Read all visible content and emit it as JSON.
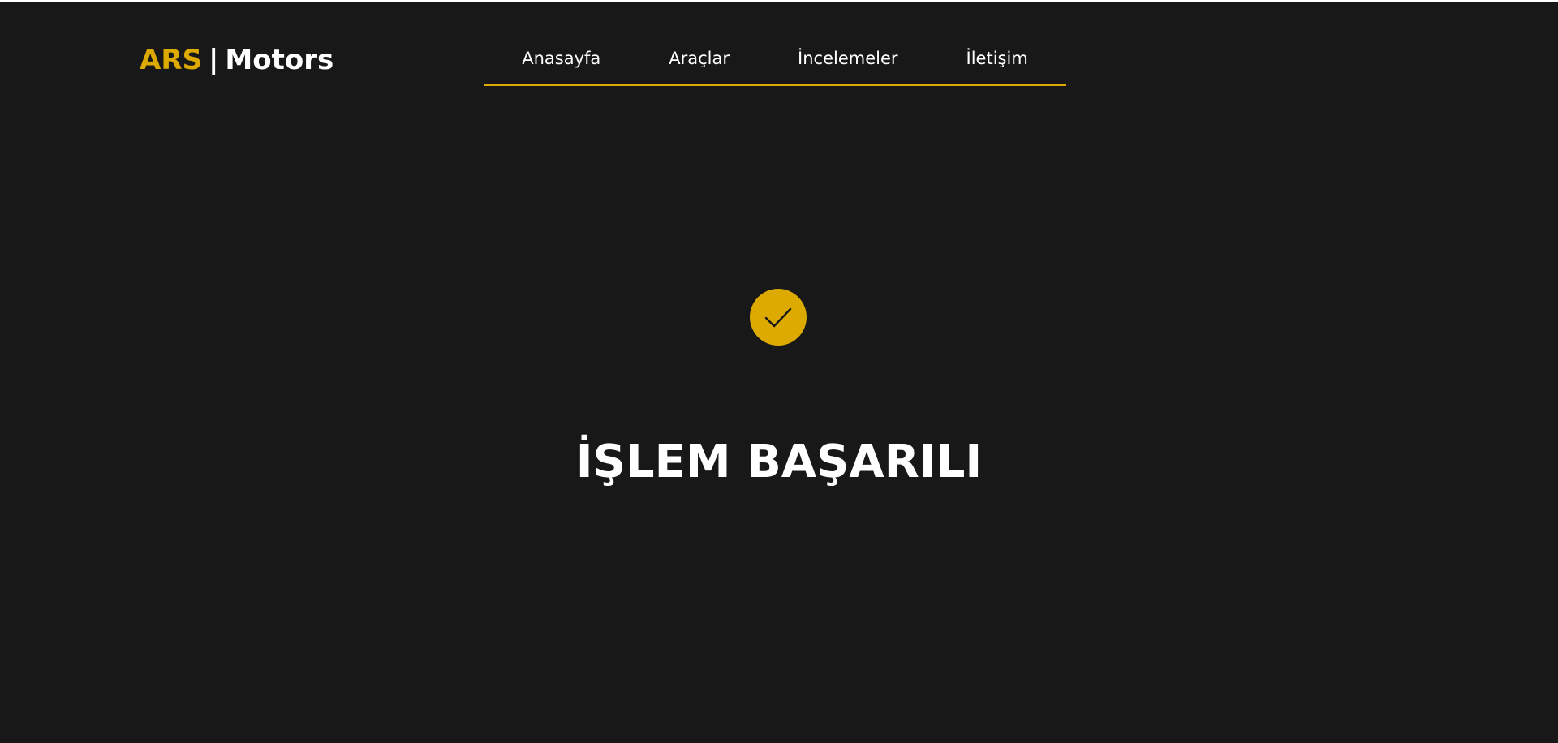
{
  "brand": {
    "accent": "ARS",
    "separator": "|",
    "name": "Motors",
    "accent_color": "#dcaa00"
  },
  "nav": {
    "items": [
      {
        "label": "Anasayfa"
      },
      {
        "label": "Araçlar"
      },
      {
        "label": "İncelemeler"
      },
      {
        "label": "İletişim"
      }
    ]
  },
  "status": {
    "icon": "check-icon",
    "title": "İŞLEM BAŞARILI"
  },
  "colors": {
    "background": "#181818",
    "accent": "#dcaa00",
    "text": "#ffffff"
  }
}
